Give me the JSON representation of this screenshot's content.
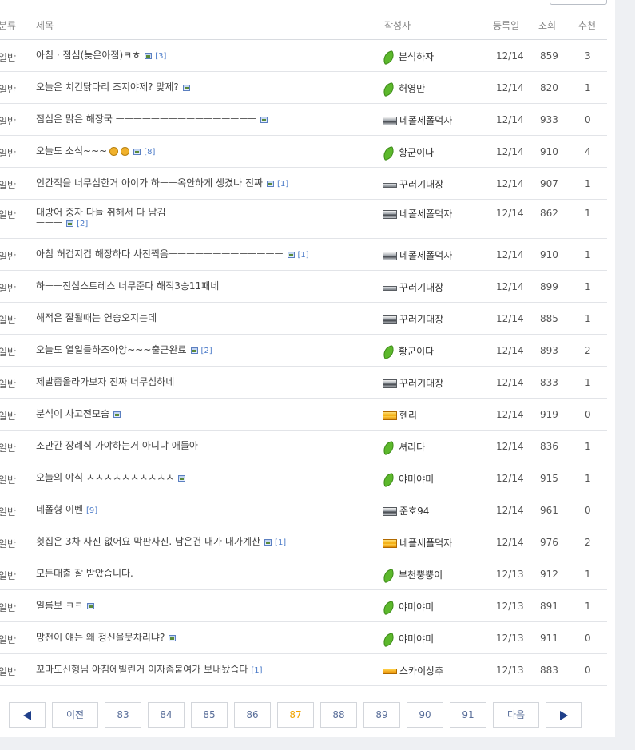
{
  "header": {
    "category": "분류",
    "title": "제목",
    "author": "작성자",
    "date": "등록일",
    "views": "조회",
    "recommend": "추천"
  },
  "rows": [
    {
      "category": "일반",
      "title": "아침 · 점심(늦은아점)ㅋㅎ",
      "image": true,
      "comments": "[3]",
      "author": "분석하자",
      "level": "leaf",
      "date": "12/14",
      "views": "859",
      "recommend": "3"
    },
    {
      "category": "일반",
      "title": "오늘은 치킨닭다리 조지야제? 맞제?",
      "image": true,
      "comments": "",
      "author": "허영만",
      "level": "leaf",
      "date": "12/14",
      "views": "820",
      "recommend": "1"
    },
    {
      "category": "일반",
      "title": "점심은 맑은 해장국 ㅡㅡㅡㅡㅡㅡㅡㅡㅡㅡㅡㅡㅡㅡㅡㅡ",
      "image": true,
      "comments": "",
      "author": "네폴세폴먹자",
      "level": "silver",
      "date": "12/14",
      "views": "933",
      "recommend": "0"
    },
    {
      "category": "일반",
      "title": "오늘도 소식~~~",
      "image": true,
      "comments": "[8]",
      "author": "황군이다",
      "level": "leaf",
      "date": "12/14",
      "views": "910",
      "recommend": "4"
    },
    {
      "category": "일반",
      "title": "인간적을 너무심한거 아이가 하ㅡㅡ옥안하게 생겼나 진짜",
      "image": true,
      "comments": "[1]",
      "author": "꾸러기대장",
      "level": "silver-thin",
      "date": "12/14",
      "views": "907",
      "recommend": "1"
    },
    {
      "category": "일반",
      "title": "대방어 중자 다들 취해서 다 남김 ㅡㅡㅡㅡㅡㅡㅡㅡㅡㅡㅡㅡㅡㅡㅡㅡㅡㅡㅡㅡㅡㅡㅡㅡㅡㅡ",
      "image": true,
      "comments": "[2]",
      "author": "네폴세폴먹자",
      "level": "silver",
      "date": "12/14",
      "views": "862",
      "recommend": "1"
    },
    {
      "category": "일반",
      "title": "아침 허겁지겁 해장하다 사진찍음ㅡㅡㅡㅡㅡㅡㅡㅡㅡㅡㅡㅡㅡ",
      "image": true,
      "comments": "[1]",
      "author": "네폴세폴먹자",
      "level": "silver",
      "date": "12/14",
      "views": "910",
      "recommend": "1"
    },
    {
      "category": "일반",
      "title": "하ㅡㅡ진심스트레스 너무준다 해적3승11패네",
      "image": false,
      "comments": "",
      "author": "꾸러기대장",
      "level": "silver-thin",
      "date": "12/14",
      "views": "899",
      "recommend": "1"
    },
    {
      "category": "일반",
      "title": "해적은 잘될때는 연승오지는데",
      "image": false,
      "comments": "",
      "author": "꾸러기대장",
      "level": "silver",
      "date": "12/14",
      "views": "885",
      "recommend": "1"
    },
    {
      "category": "일반",
      "title": "오늘도 열일들하즈아앙~~~출근완료",
      "image": true,
      "comments": "[2]",
      "author": "황군이다",
      "level": "leaf",
      "date": "12/14",
      "views": "893",
      "recommend": "2"
    },
    {
      "category": "일반",
      "title": "제발좀올라가보자 진짜 너무심하네",
      "image": false,
      "comments": "",
      "author": "꾸러기대장",
      "level": "silver",
      "date": "12/14",
      "views": "833",
      "recommend": "1"
    },
    {
      "category": "일반",
      "title": "분석이 사고전모습",
      "image": true,
      "comments": "",
      "author": "헨리",
      "level": "gold",
      "date": "12/14",
      "views": "919",
      "recommend": "0"
    },
    {
      "category": "일반",
      "title": "조만간 장례식 가야하는거 아니냐 애들아",
      "image": false,
      "comments": "",
      "author": "셔리다",
      "level": "leaf",
      "date": "12/14",
      "views": "836",
      "recommend": "1"
    },
    {
      "category": "일반",
      "title": "오늘의 야식 ㅅㅅㅅㅅㅅㅅㅅㅅㅅㅅ",
      "image": true,
      "comments": "",
      "author": "야미야미",
      "level": "leaf",
      "date": "12/14",
      "views": "915",
      "recommend": "1"
    },
    {
      "category": "일반",
      "title": "네폴형 이벤",
      "image": false,
      "comments": "[9]",
      "author": "준호94",
      "level": "silver",
      "date": "12/14",
      "views": "961",
      "recommend": "0"
    },
    {
      "category": "일반",
      "title": "횟집은 3차 사진 없어요 막판사진. 남은건 내가 내가계산",
      "image": true,
      "comments": "[1]",
      "author": "네폴세폴먹자",
      "level": "gold",
      "date": "12/14",
      "views": "976",
      "recommend": "2"
    },
    {
      "category": "일반",
      "title": "모든대출 잘 받았습니다.",
      "image": false,
      "comments": "",
      "author": "부천뿡뿡이",
      "level": "leaf",
      "date": "12/13",
      "views": "912",
      "recommend": "1"
    },
    {
      "category": "일반",
      "title": "일름보 ㅋㅋ",
      "image": true,
      "comments": "",
      "author": "야미야미",
      "level": "leaf",
      "date": "12/13",
      "views": "891",
      "recommend": "1"
    },
    {
      "category": "일반",
      "title": "망천이 얘는 왜 정신을못차리냐?",
      "image": true,
      "comments": "",
      "author": "야미야미",
      "level": "leaf",
      "date": "12/13",
      "views": "911",
      "recommend": "0"
    },
    {
      "category": "일반",
      "title": "꼬마도신형님 아침에빌린거 이자좀붙여가 보내놨습다",
      "image": false,
      "comments": "[1]",
      "author": "스카이상추",
      "level": "gold-thin",
      "date": "12/13",
      "views": "883",
      "recommend": "0"
    }
  ],
  "pagination": {
    "prev_label": "이전",
    "next_label": "다음",
    "pages": [
      "83",
      "84",
      "85",
      "86",
      "87",
      "88",
      "89",
      "90",
      "91"
    ],
    "current": "87"
  },
  "colors": {
    "accent": "#f0a400",
    "link": "#4a7ac8",
    "arrow": "#1f3f8a"
  }
}
